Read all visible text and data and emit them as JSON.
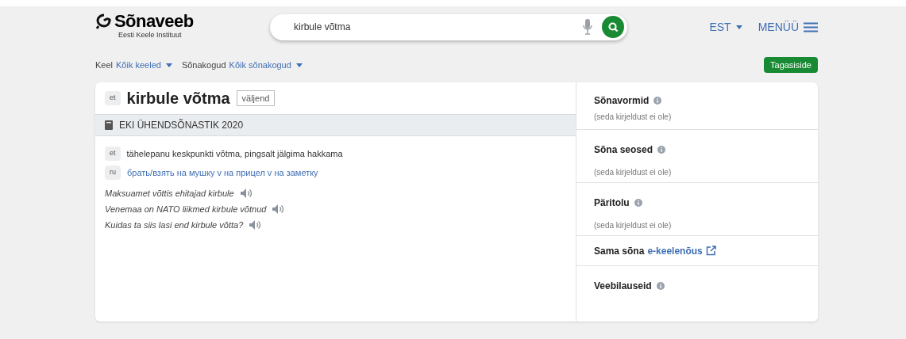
{
  "logo": {
    "name": "Sõnaveeb",
    "subtitle": "Eesti Keele Instituut"
  },
  "search": {
    "value": "kirbule võtma"
  },
  "language_menu": "EST",
  "menu": "MENÜÜ",
  "filters": [
    {
      "label": "Keel",
      "value": "Kõik keeled"
    },
    {
      "label": "Sõnakogud",
      "value": "Kõik sõnakogud"
    }
  ],
  "feedback_button": "Tagasiside",
  "entry": {
    "lang": "et",
    "headword": "kirbule võtma",
    "type": "väljend",
    "dictionary": "EKI ÜHENDSÕNASTIK 2020",
    "definitions": [
      {
        "lang": "et",
        "text": "tähelepanu keskpunkti võtma, pingsalt jälgima hakkama",
        "kind": "definition"
      },
      {
        "lang": "ru",
        "text": "брать/взять на мушку v на прицел v на заметку",
        "kind": "translation"
      }
    ],
    "examples": [
      "Maksuamet võttis ehitajad kirbule",
      "Venemaa on NATO liikmed kirbule võtnud",
      "Kuidas ta siis lasi end kirbule võtta?"
    ]
  },
  "side_sections": [
    {
      "kind": "info",
      "title": "Sõnavormid",
      "note": "(seda kirjeldust ei ole)"
    },
    {
      "kind": "info",
      "title": "Sõna seosed",
      "note": "(seda kirjeldust ei ole)"
    },
    {
      "kind": "info",
      "title": "Päritolu",
      "note": "(seda kirjeldust ei ole)"
    },
    {
      "kind": "link",
      "title": "Sama sõna",
      "link": "e-keelenõus"
    },
    {
      "kind": "info",
      "title": "Veebilauseid"
    }
  ]
}
